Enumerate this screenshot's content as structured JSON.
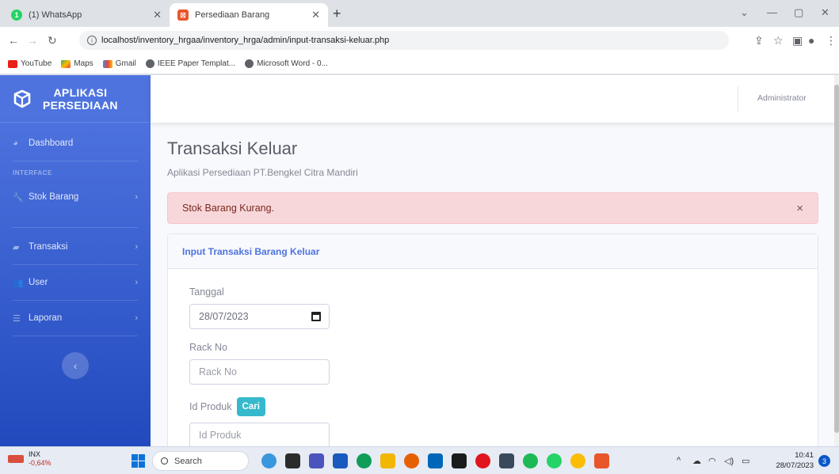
{
  "browser": {
    "tabs": [
      {
        "label": "(1) WhatsApp",
        "active": false
      },
      {
        "label": "Persediaan Barang",
        "active": true
      }
    ],
    "new_tab_icon": "plus-icon",
    "url": "localhost/inventory_hrgaa/inventory_hrga/admin/input-transaksi-keluar.php",
    "bookmarks": [
      "YouTube",
      "Maps",
      "Gmail",
      "IEEE Paper Templat...",
      "Microsoft Word - 0..."
    ]
  },
  "sidebar": {
    "brand": "APLIKASI PERSEDIAAN",
    "brand_line1": "APLIKASI",
    "brand_line2": "PERSEDIAAN",
    "dashboard": "Dashboard",
    "heading": "INTERFACE",
    "items": [
      {
        "label": "Stok Barang",
        "icon": "wrench-icon"
      },
      {
        "label": "Transaksi",
        "icon": "truck-icon"
      },
      {
        "label": "User",
        "icon": "users-icon"
      },
      {
        "label": "Laporan",
        "icon": "list-icon"
      }
    ],
    "toggle_icon": "chevron-left-icon"
  },
  "topbar": {
    "user": "Administrator"
  },
  "page": {
    "title": "Transaksi Keluar",
    "subtitle": "Aplikasi Persediaan PT.Bengkel Citra Mandiri",
    "alert": "Stok Barang Kurang.",
    "alert_close": "×",
    "card_title": "Input Transaksi Barang Keluar",
    "form": {
      "tanggal_label": "Tanggal",
      "tanggal_value": "28/07/2023",
      "rack_label": "Rack No",
      "rack_placeholder": "Rack No",
      "produk_label": "Id Produk",
      "cari_button": "Cari",
      "produk_placeholder": "Id Produk"
    }
  },
  "taskbar": {
    "stock_name": "INX",
    "stock_change": "-0,64%",
    "search": "Search",
    "time": "10:41",
    "date": "28/07/2023",
    "notifications": "3"
  }
}
